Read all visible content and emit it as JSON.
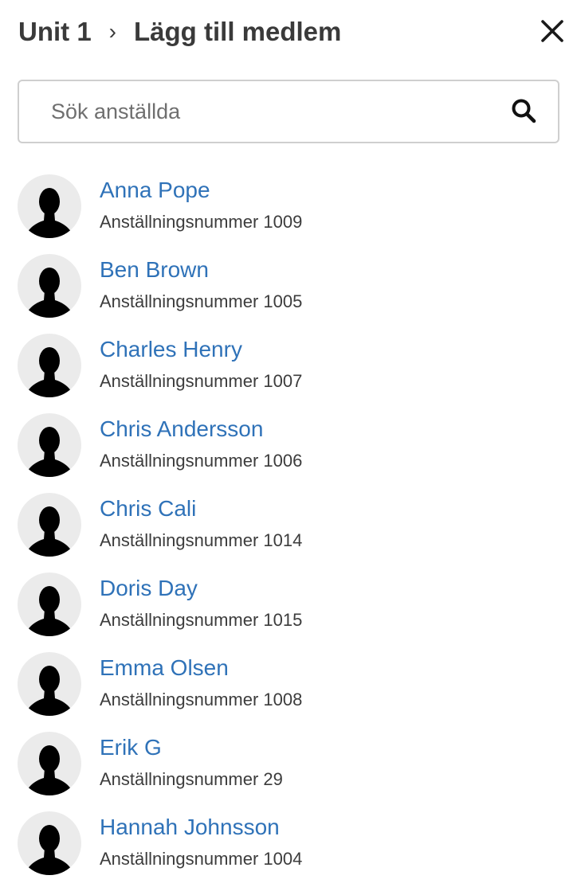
{
  "header": {
    "crumb_parent": "Unit 1",
    "crumb_separator": "›",
    "title": "Lägg till medlem",
    "close_icon": "close-icon"
  },
  "search": {
    "placeholder": "Sök anställda",
    "value": "",
    "icon": "search-icon"
  },
  "employees": [
    {
      "name": "Anna Pope",
      "number_label": "Anställningsnummer 1009"
    },
    {
      "name": "Ben Brown",
      "number_label": "Anställningsnummer 1005"
    },
    {
      "name": "Charles Henry",
      "number_label": "Anställningsnummer 1007"
    },
    {
      "name": "Chris Andersson",
      "number_label": "Anställningsnummer 1006"
    },
    {
      "name": "Chris Cali",
      "number_label": "Anställningsnummer 1014"
    },
    {
      "name": "Doris Day",
      "number_label": "Anställningsnummer 1015"
    },
    {
      "name": "Emma Olsen",
      "number_label": "Anställningsnummer 1008"
    },
    {
      "name": "Erik G",
      "number_label": "Anställningsnummer 29"
    },
    {
      "name": "Hannah Johnsson",
      "number_label": "Anställningsnummer 1004"
    }
  ],
  "colors": {
    "link": "#2f72b8",
    "text": "#3a3a3a",
    "border": "#cfcfcf",
    "avatar_bg": "#ebebeb",
    "avatar_fg": "#000000"
  }
}
